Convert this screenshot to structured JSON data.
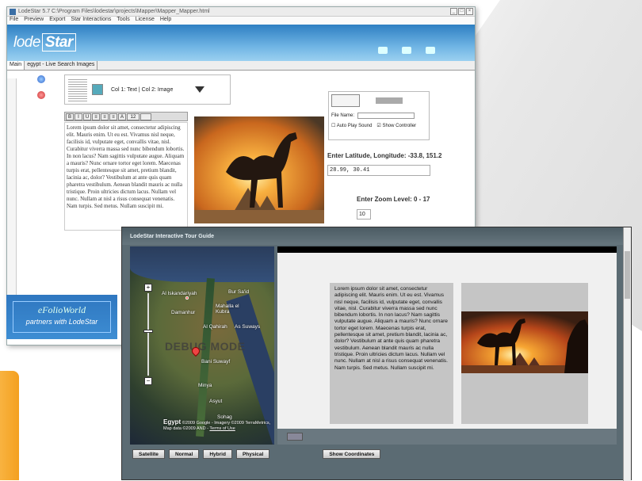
{
  "editor": {
    "title": "LodeStar 5.7    C:\\Program Files\\lodestar\\projects\\Mapper\\Mapper_Mapper.html",
    "menu": [
      "File",
      "Preview",
      "Export",
      "Star Interactions",
      "Tools",
      "License",
      "Help"
    ],
    "logo_text": "lode",
    "logo_star": "Star",
    "tabs": [
      "Main",
      "egypt - Live Search Images"
    ],
    "cell_label": "Col 1: Text | Col 2: Image",
    "rte_font_size": "12",
    "body_text": "Lorem ipsum dolor sit amet, consectetur adipiscing elit. Mauris enim. Ut eu est. Vivamus nisl neque, facilisis id, vulputate eget, convallis vitae, nisl. Curabitur viverra massa sed nunc bibendum lobortis. In non lacus? Nam sagittis vulputate augue. Aliquam a mauris? Nunc ornare tortor eget lorem. Maecenas turpis erat, pellentesque sit amet, pretium blandit, lacinia ac, dolor? Vestibulum at ante quis quam pharetra vestibulum. Aenean blandit mauris ac nulla tristique. Proin ultricies dictum lacus. Nullam vel nunc. Nullam at nisl a risus consequat venenatis. Nam turpis. Sed metus. Nullam suscipit mi.",
    "file_name_label": "File Name:",
    "autoplay_label": "Auto Play Sound",
    "show_controller_label": "Show Controller",
    "latlong_label": "Enter Latitude, Longitude: -33.8, 151.2",
    "latlong_value": "28.99, 30.41",
    "zoom_label": "Enter Zoom Level: 0 - 17",
    "zoom_value": "10",
    "plus": "+",
    "minus": "-"
  },
  "efolio": {
    "brand": "eFolioWorld",
    "tagline": "partners with LodeStar"
  },
  "tour": {
    "title": "LodeStar Interactive Tour Guide",
    "map_labels": [
      "Al Iskandariyah",
      "Bur Sa'id",
      "Damanhur",
      "Mahalla el Kubra",
      "Al Qahirah",
      "As Suways",
      "Bani Suwayf",
      "Minya",
      "Asyut",
      "Sohag"
    ],
    "debug_text": "DEBUG MODE",
    "map_country": "Egypt",
    "map_copyright": "©2009 Google - Imagery ©2009 TerraMetrics, Map data ©2009 AND -",
    "terms_label": "Terms of Use",
    "body_text": "Lorem ipsum dolor sit amet, consectetur adipiscing elit. Mauris enim. Ut eu est. Vivamus nisl neque, facilisis id, vulputate eget, convallis vitae, nisl. Curabitur viverra massa sed nunc bibendum lobortis. In non lacus? Nam sagittis vulputate augue. Aliquam a mauris? Nunc ornare tortor eget lorem. Maecenas turpis erat, pellentesque sit amet, pretium blandit, lacinia ac, dolor? Vestibulum at ante quis quam pharetra vestibulum. Aenean blandit mauris ac nulla tristique. Proin ultricies dictum lacus. Nullam vel nunc. Nullam at nisl a risus consequat venenatis. Nam turpis. Sed metus. Nullam suscipit mi.",
    "buttons": {
      "satellite": "Satellite",
      "normal": "Normal",
      "hybrid": "Hybrid",
      "physical": "Physical",
      "show_coordinates": "Show Coordinates"
    }
  },
  "colors": {
    "banner_blue": "#2e7fc2",
    "tour_frame": "#5b6b73",
    "panel_gray": "#c5c5c5"
  }
}
